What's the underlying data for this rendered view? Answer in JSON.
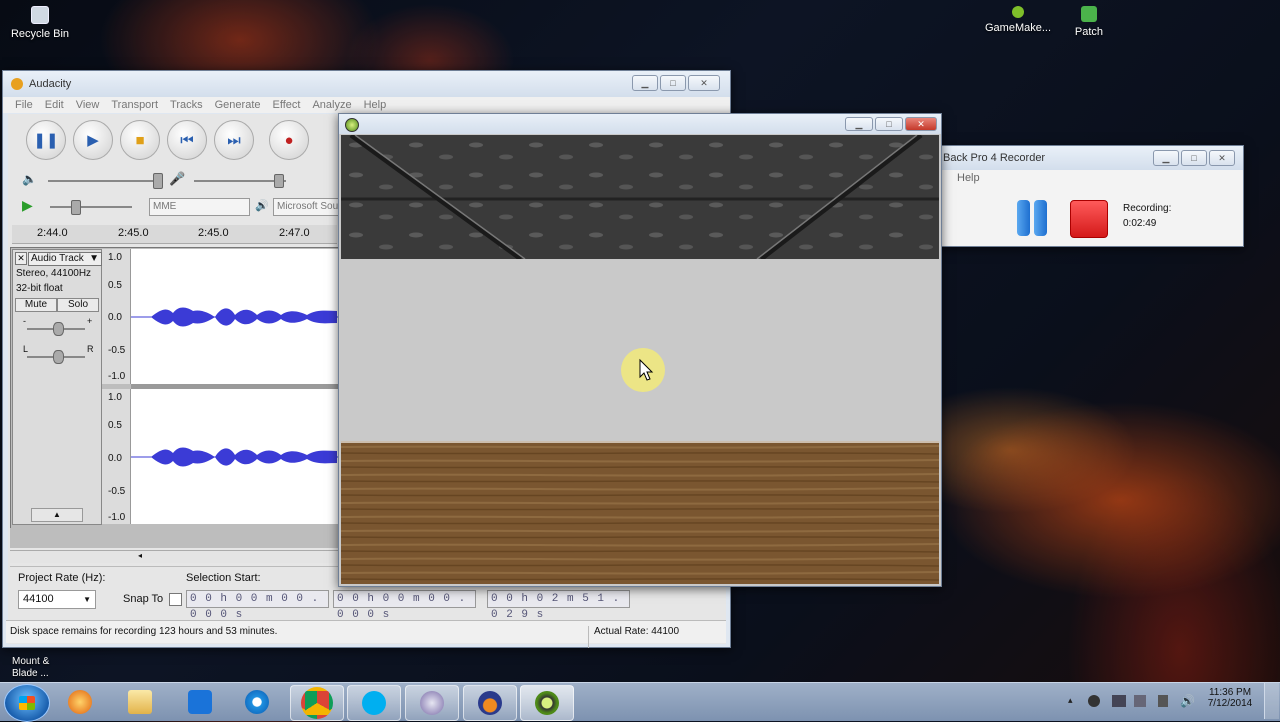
{
  "desktop": {
    "icons": [
      {
        "label": "Recycle Bin"
      },
      {
        "label": "GameMake..."
      },
      {
        "label": "Patch"
      },
      {
        "label": "Mount &\nBlade ..."
      }
    ]
  },
  "audacity": {
    "title": "Audacity",
    "menu": [
      "File",
      "Edit",
      "View",
      "Transport",
      "Tracks",
      "Generate",
      "Effect",
      "Analyze",
      "Help"
    ],
    "device_host": "MME",
    "device_output": "Microsoft Sou",
    "ruler_ticks": [
      "2:44.0",
      "2:45.0",
      "2:45.0",
      "2:47.0"
    ],
    "track": {
      "name": "Audio Track",
      "info1": "Stereo, 44100Hz",
      "info2": "32-bit float",
      "mute_label": "Mute",
      "solo_label": "Solo",
      "gain_minus": "-",
      "gain_plus": "+",
      "pan_left": "L",
      "pan_right": "R"
    },
    "scale_labels": [
      "1.0",
      "0.5",
      "0.0",
      "-0.5",
      "-1.0"
    ],
    "project_rate_label": "Project Rate (Hz):",
    "project_rate_value": "44100",
    "snap_to_label": "Snap To",
    "selection_start_label": "Selection Start:",
    "selection_start_value": "0 0 h 0 0 m 0 0 . 0 0 0 s",
    "selection_end_value": "0 0 h 0 0 m 0 0 . 0 0 0 s",
    "audio_position_value": "0 0 h 0 2 m 5 1 . 0 2 9 s",
    "status_left": "Disk space remains for recording 123 hours and 53 minutes.",
    "status_right": "Actual Rate: 44100"
  },
  "recorder": {
    "title": "Back Pro 4 Recorder",
    "menu_help": "Help",
    "recording_label": "Recording:",
    "recording_time": "0:02:49"
  },
  "taskbar": {
    "clock_time": "11:36 PM",
    "clock_date": "7/12/2014",
    "apps": [
      "start",
      "media-player",
      "explorer",
      "teamviewer",
      "internet-explorer",
      "chrome",
      "skype",
      "audio-app",
      "audacity",
      "gamemaker-game"
    ]
  },
  "colors": {
    "wave": "#3b3bd6",
    "record_red": "#e0262b",
    "pause_blue": "#1e7fe0",
    "floor": "#7a5630",
    "wall": "#c9c9c9"
  }
}
